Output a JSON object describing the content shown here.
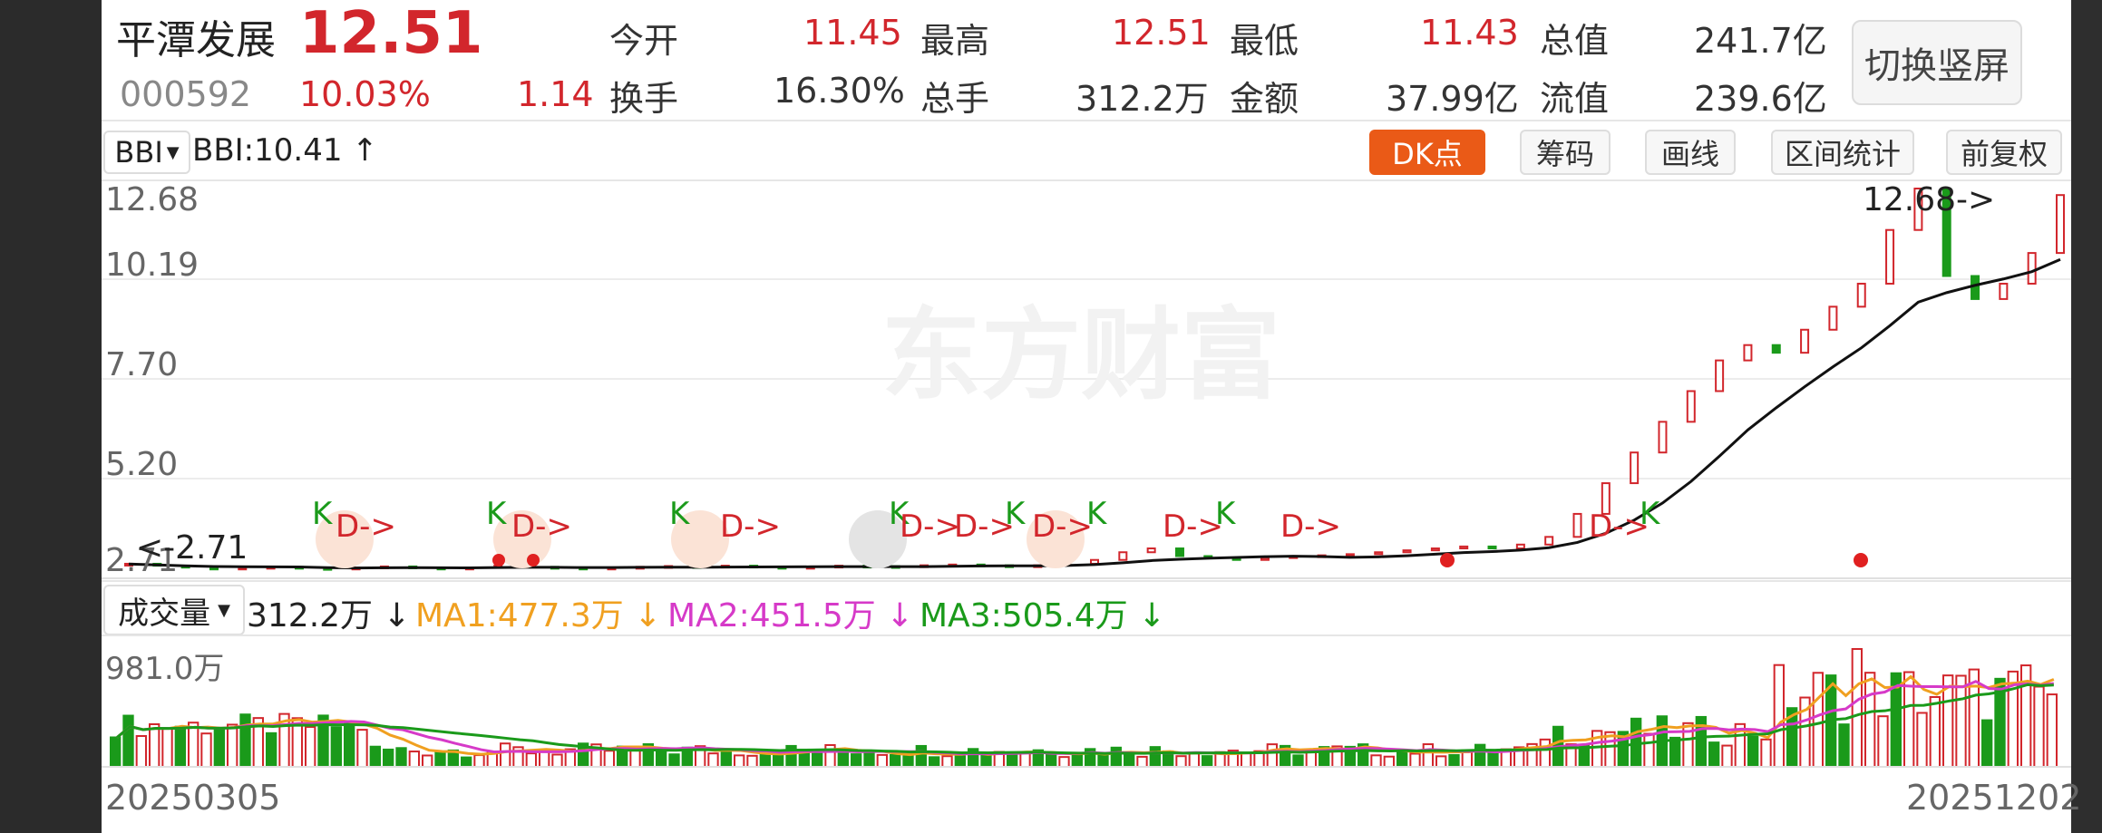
{
  "stock": {
    "name": "平潭发展",
    "code": "000592",
    "price": "12.51",
    "change_pct": "10.03%",
    "change_amt": "1.14"
  },
  "quote": {
    "row1": [
      {
        "label": "今开",
        "value": "11.45"
      },
      {
        "label": "最高",
        "value": "12.51"
      },
      {
        "label": "最低",
        "value": "11.43"
      },
      {
        "label": "总值",
        "value": "241.7亿"
      }
    ],
    "row2": [
      {
        "label": "换手",
        "value": "16.30%"
      },
      {
        "label": "总手",
        "value": "312.2万"
      },
      {
        "label": "金额",
        "value": "37.99亿"
      },
      {
        "label": "流值",
        "value": "239.6亿"
      }
    ]
  },
  "switch_button": "切换竖屏",
  "toolbar": {
    "indicator_select": "BBI",
    "indicator_value": "BBI:10.41",
    "dk_button": "DK点",
    "chip_button": "筹码",
    "draw_button": "画线",
    "range_stats_button": "区间统计",
    "adjust_button": "前复权"
  },
  "price_axis": [
    "12.68",
    "10.19",
    "7.70",
    "5.20",
    "2.71"
  ],
  "annotations": {
    "high_marker": "12.68->",
    "low_marker": "<-2.71"
  },
  "signals": [
    "K",
    "D->",
    "K",
    "D->",
    "K",
    "D->",
    "K",
    "D->",
    "D->",
    "K",
    "D->",
    "K",
    "D->",
    "K",
    "D->",
    "D->",
    "K"
  ],
  "watermark": "东方财富",
  "volume": {
    "select": "成交量",
    "value": "312.2万",
    "ma1": "MA1:477.3万",
    "ma2": "MA2:451.5万",
    "ma3": "MA3:505.4万",
    "axis_top": "981.0万"
  },
  "dates": {
    "start": "20250305",
    "end": "20251202"
  },
  "colors": {
    "up": "#d2262c",
    "down": "#1a9a1a",
    "bbi": "#111111",
    "ma1": "#f0a020",
    "ma2": "#d63ac8",
    "ma3": "#1a9a1a",
    "dk": "#ea5a17"
  },
  "chart_data": {
    "type": "candlestick",
    "price_range": [
      2.71,
      12.68
    ],
    "volume_max": "981.0万",
    "close_series": [
      2.9,
      2.85,
      2.8,
      2.78,
      2.8,
      2.82,
      2.79,
      2.77,
      2.8,
      2.83,
      2.8,
      2.78,
      2.8,
      2.85,
      2.82,
      2.8,
      2.78,
      2.8,
      2.82,
      2.84,
      2.83,
      2.85,
      2.82,
      2.8,
      2.82,
      2.85,
      2.84,
      2.83,
      2.86,
      2.88,
      2.86,
      2.84,
      2.86,
      2.9,
      3.0,
      3.2,
      3.3,
      3.1,
      3.05,
      3.0,
      3.05,
      3.1,
      3.12,
      3.15,
      3.2,
      3.25,
      3.3,
      3.35,
      3.3,
      3.4,
      3.6,
      4.2,
      5.0,
      5.8,
      6.6,
      7.4,
      8.2,
      8.6,
      8.4,
      9.0,
      9.6,
      10.2,
      11.6,
      12.68,
      10.4,
      9.8,
      10.2,
      11.0,
      12.51
    ],
    "bbi_range": [
      2.71,
      10.41
    ]
  }
}
